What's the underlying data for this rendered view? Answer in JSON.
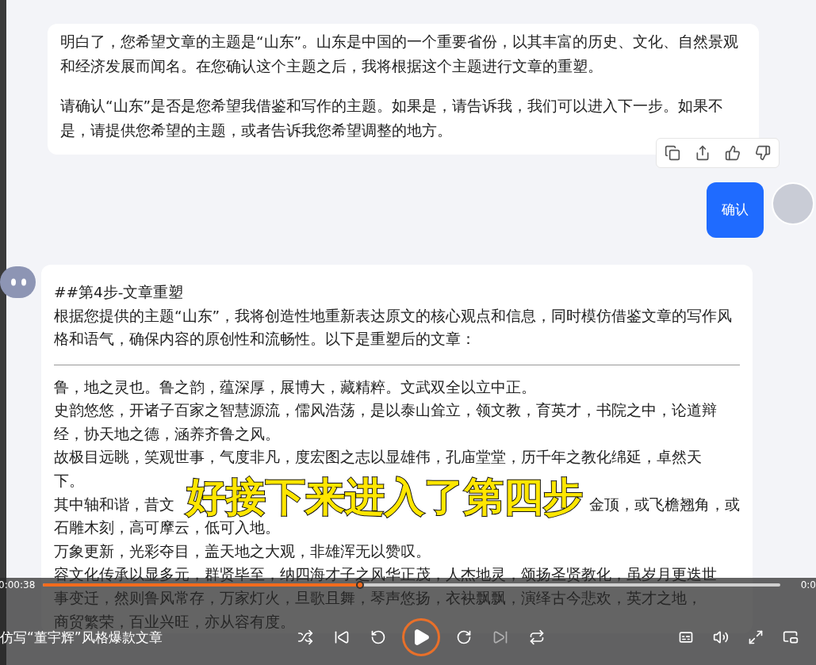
{
  "reply_1": {
    "paragraphs": [
      "明白了，您希望文章的主题是“山东”。山东是中国的一个重要省份，以其丰富的历史、文化、自然景观和经济发展而闻名。在您确认这个主题之后，我将根据这个主题进行文章的重塑。",
      "请确认“山东”是否是您希望我借鉴和写作的主题。如果是，请告诉我，我们可以进入下一步。如果不是，请提供您希望的主题，或者告诉我您希望调整的地方。"
    ],
    "actions": [
      {
        "kind": "copy"
      },
      {
        "kind": "share"
      },
      {
        "kind": "like"
      },
      {
        "kind": "dislike"
      }
    ]
  },
  "user_message": {
    "text": "确认"
  },
  "reply_2": {
    "heading": "##第4步-文章重塑",
    "intro": "根据您提供的主题“山东”，我将创造性地重新表达原文的核心观点和信息，同时模仿借鉴文章的写作风格和语气，确保内容的原创性和流畅性。以下是重塑后的文章：",
    "lines": [
      {
        "parts": [
          "鲁，地之灵也。鲁之韵，蕴深厚，展博大，藏精粹。文武双全以立中正。"
        ]
      },
      {
        "parts": [
          "史韵悠悠，开诸子百家之智慧源流，儒风浩荡，是以泰山耸立，领文教，育英才，书院之中，论道辩"
        ]
      },
      {
        "parts": [
          "经，协天地之德，涵养齐鲁之风。"
        ]
      },
      {
        "parts": [
          "故极目远眺，笑观世事，气度非凡，度宏图之志以显雄伟，孔庙堂堂，历千年之教化绵延，卓然天"
        ]
      },
      {
        "parts": [
          "下。"
        ]
      },
      {
        "parts": [
          "其中轴和谐，昔文",
          "金顶，或飞檐翘角，或"
        ]
      },
      {
        "parts": [
          "石雕木刻，高可摩云，低可入地。"
        ]
      },
      {
        "parts": [
          "万象更新，光彩夺目，盖天地之大观，非雄浑无以赞叹。"
        ]
      },
      {
        "parts": [
          "容文化传承以显多元，群贤毕至，纳四海才子之风华正茂，人杰地灵，颂扬圣贤教化，虽岁月更迭世"
        ]
      },
      {
        "parts": [
          "事变迁，然则鲁风常存，万家灯火，旦歌且舞，琴声悠扬，衣袂飘飘，演绎古今悲欢，英才之地，"
        ]
      },
      {
        "parts": [
          "商贸繁荣，百业兴旺，亦从容有度。"
        ]
      }
    ]
  },
  "subtitle": "好接下来进入了第四步",
  "player": {
    "elapsed": "0:00:38",
    "duration": "0:0",
    "title": "仿写“董宇辉”风格爆款文章",
    "level": 0.43,
    "playing": false
  }
}
